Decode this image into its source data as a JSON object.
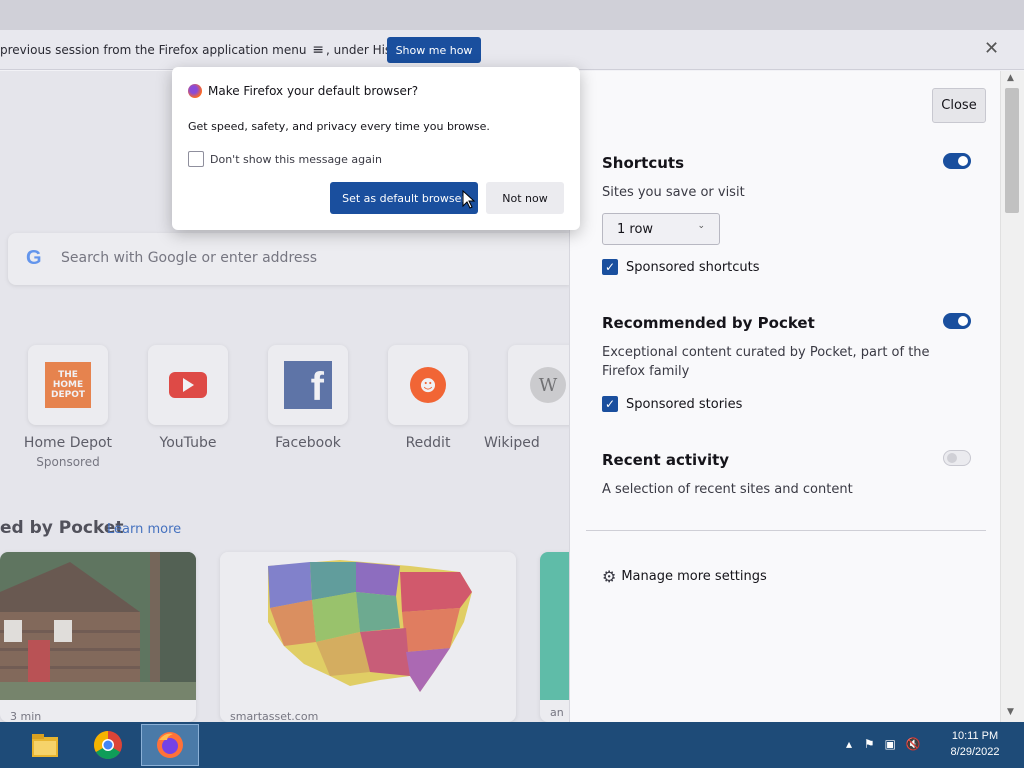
{
  "notification": {
    "text": "previous session from the Firefox application menu",
    "text_after": ", under History.",
    "show_me_how": "Show me how",
    "close": "✕"
  },
  "search": {
    "placeholder": "Search with Google or enter address"
  },
  "shortcuts": [
    {
      "label": "Home Depot",
      "sponsored": "Sponsored",
      "logo_text": "THE HOME DEPOT"
    },
    {
      "label": "YouTube",
      "sponsored": ""
    },
    {
      "label": "Facebook",
      "sponsored": "",
      "logo_text": "f"
    },
    {
      "label": "Reddit",
      "sponsored": ""
    },
    {
      "label": "Wikiped",
      "sponsored": ""
    }
  ],
  "pocket": {
    "title": "ed by Pocket",
    "learn_more": "Learn more",
    "cards": [
      {
        "source": "3 min"
      },
      {
        "source": "smartasset.com"
      },
      {
        "source": "an"
      }
    ]
  },
  "panel": {
    "close": "Close",
    "shortcuts": {
      "title": "Shortcuts",
      "subtitle": "Sites you save or visit",
      "rows_value": "1 row",
      "sponsored_label": "Sponsored shortcuts",
      "enabled": true
    },
    "pocket": {
      "title": "Recommended by Pocket",
      "subtitle": "Exceptional content curated by Pocket, part of the Firefox family",
      "sponsored_label": "Sponsored stories",
      "enabled": true
    },
    "recent": {
      "title": "Recent activity",
      "subtitle": "A selection of recent sites and content",
      "enabled": false
    },
    "manage": "Manage more settings"
  },
  "dialog": {
    "title": "Make Firefox your default browser?",
    "body": "Get speed, safety, and privacy every time you browse.",
    "checkbox_label": "Don't show this message again",
    "primary": "Set as default browser",
    "secondary": "Not now"
  },
  "taskbar": {
    "time": "10:11 PM",
    "date": "8/29/2022"
  },
  "colors": {
    "accent": "#1a4f9e",
    "taskbar": "#1e4b78"
  }
}
